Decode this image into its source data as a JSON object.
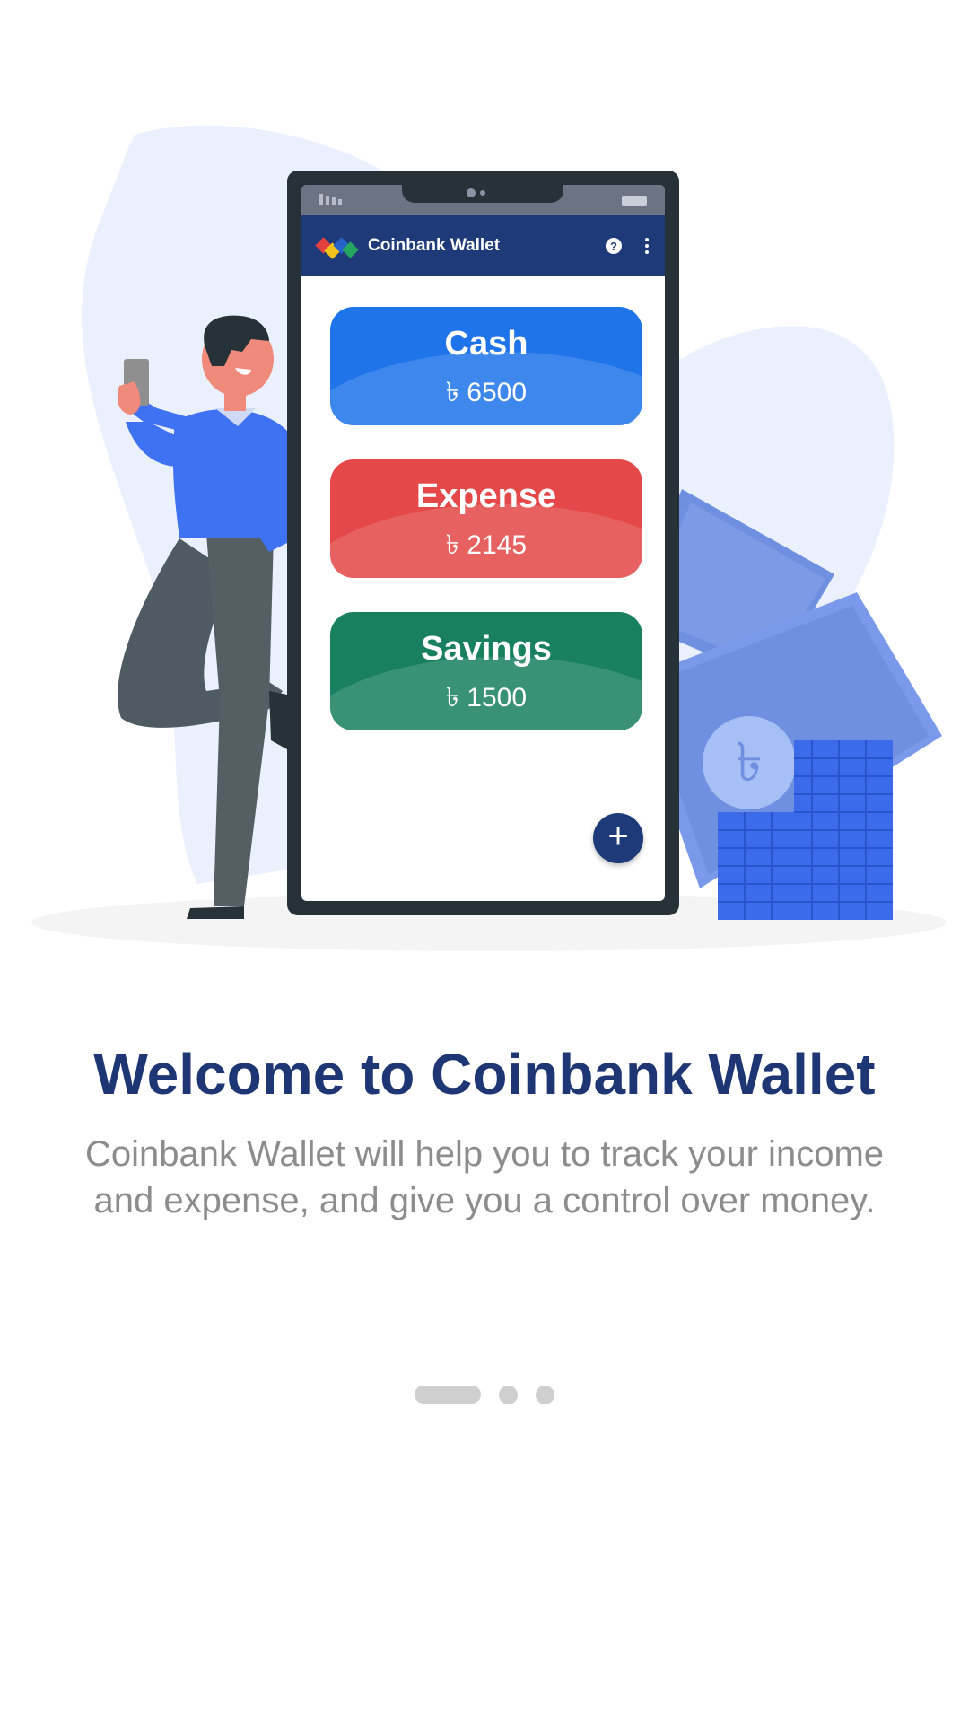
{
  "app": {
    "name": "Coinbank Wallet"
  },
  "phone_screen": {
    "app_title": "Coinbank Wallet",
    "help_icon_glyph": "?",
    "cards": [
      {
        "label": "Cash",
        "amount": "৳ 6500",
        "color": "#1f74ea"
      },
      {
        "label": "Expense",
        "amount": "৳ 2145",
        "color": "#e44848"
      },
      {
        "label": "Savings",
        "amount": "৳ 1500",
        "color": "#19805f"
      }
    ],
    "fab_glyph": "+"
  },
  "onboarding": {
    "title": "Welcome to Coinbank Wallet",
    "description": "Coinbank Wallet will help you to track your income and expense, and give you a control over money.",
    "pages_total": 3,
    "current_page": 1
  },
  "colors": {
    "primary": "#1e3a78",
    "blob": "#eaf0fd",
    "money": "#6f8fe0",
    "coins": "#3b6bea"
  },
  "icons": [
    "help-icon",
    "more-vert-icon",
    "plus-icon",
    "logo-icon",
    "signal-icon",
    "battery-icon"
  ]
}
